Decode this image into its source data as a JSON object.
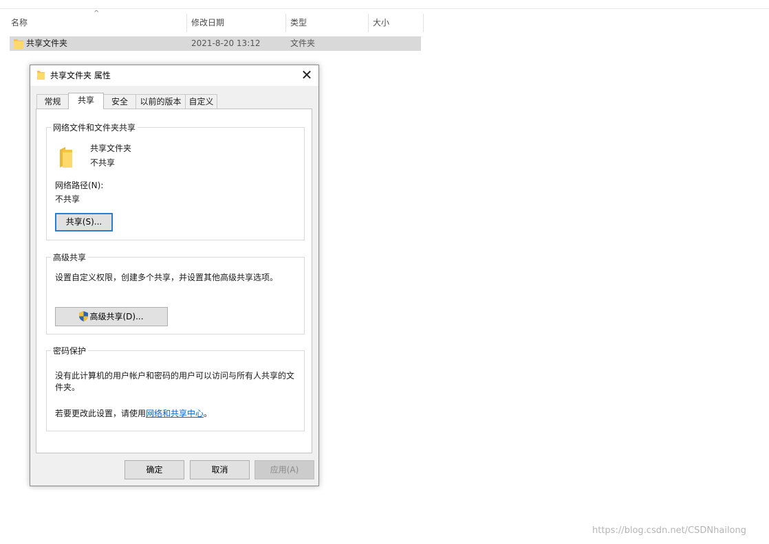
{
  "explorer": {
    "columns": {
      "name": "名称",
      "modified": "修改日期",
      "type": "类型",
      "size": "大小"
    },
    "row": {
      "name": "共享文件夹",
      "modified": "2021-8-20 13:12",
      "type": "文件夹",
      "size": ""
    }
  },
  "dialog": {
    "title": "共享文件夹 属性",
    "close_glyph": "✕",
    "tabs": [
      "常规",
      "共享",
      "安全",
      "以前的版本",
      "自定义"
    ],
    "active_tab": "共享",
    "network_share": {
      "legend": "网络文件和文件夹共享",
      "folder_name": "共享文件夹",
      "folder_status": "不共享",
      "path_label": "网络路径(N):",
      "path_value": "不共享",
      "share_button": "共享(S)..."
    },
    "advanced_share": {
      "legend": "高级共享",
      "description": "设置自定义权限，创建多个共享，并设置其他高级共享选项。",
      "button": "高级共享(D)..."
    },
    "password": {
      "legend": "密码保护",
      "description": "没有此计算机的用户帐户和密码的用户可以访问与所有人共享的文件夹。",
      "change_prefix": "若要更改此设置，请使用",
      "link": "网络和共享中心",
      "change_suffix": "。"
    },
    "buttons": {
      "ok": "确定",
      "cancel": "取消",
      "apply": "应用(A)"
    }
  },
  "watermark": "https://blog.csdn.net/CSDNhailong",
  "colors": {
    "accent": "#2b7bd0",
    "link": "#0066cc",
    "folder": "#f5c542",
    "row_selected": "#d9d9d9",
    "shield_blue": "#2a63b8",
    "shield_yellow": "#f2c230"
  }
}
